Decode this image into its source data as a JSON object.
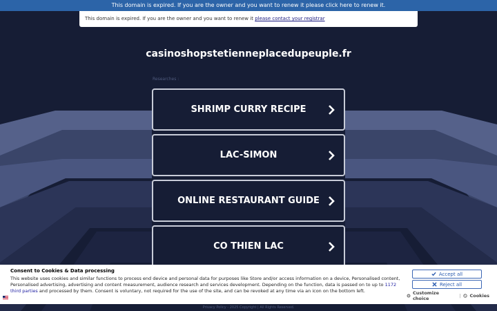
{
  "top_banner": {
    "text": "This domain is expired. If you are the owner and you want to renew it please click here to renew it."
  },
  "expired_notice": {
    "text": "This domain is expired. If you are the owner and you want to renew it",
    "link": "please contact your registrar"
  },
  "domain_name": "casinoshopstetienneplacedupeuple.fr",
  "researches_label": "Researches :",
  "search_links": [
    {
      "label": "SHRIMP CURRY RECIPE"
    },
    {
      "label": "LAC-SIMON"
    },
    {
      "label": "ONLINE RESTAURANT GUIDE"
    },
    {
      "label": "CO THIEN LAC"
    }
  ],
  "footer": {
    "privacy": "Privacy Policy",
    "copyright": "2025 Copyright | All Rights Reserved."
  },
  "cookie_banner": {
    "title": "Consent to Cookies & Data processing",
    "body_before": "This website uses cookies and similar functions to process end device and personal data for purposes like Store and/or access information on a device, Personalised content, Personalised advertising, advertising and content measurement, audience research and services development. Depending on the function, data is passed on to up to",
    "third_parties_link": "1172 third parties",
    "body_after": "and processed by them. Consent is voluntary, not required for the use of the site, and can be revoked at any time via an icon on the bottom left.",
    "accept_label": "Accept all",
    "reject_label": "Reject all",
    "customize_label": "Customize choice",
    "separator": "|",
    "cookies_label": "Cookies"
  },
  "colors": {
    "background": "#161d35",
    "banner_blue": "#2c64a8",
    "button_border": "#c8ccd8",
    "cookie_accent": "#2b5cb0"
  }
}
